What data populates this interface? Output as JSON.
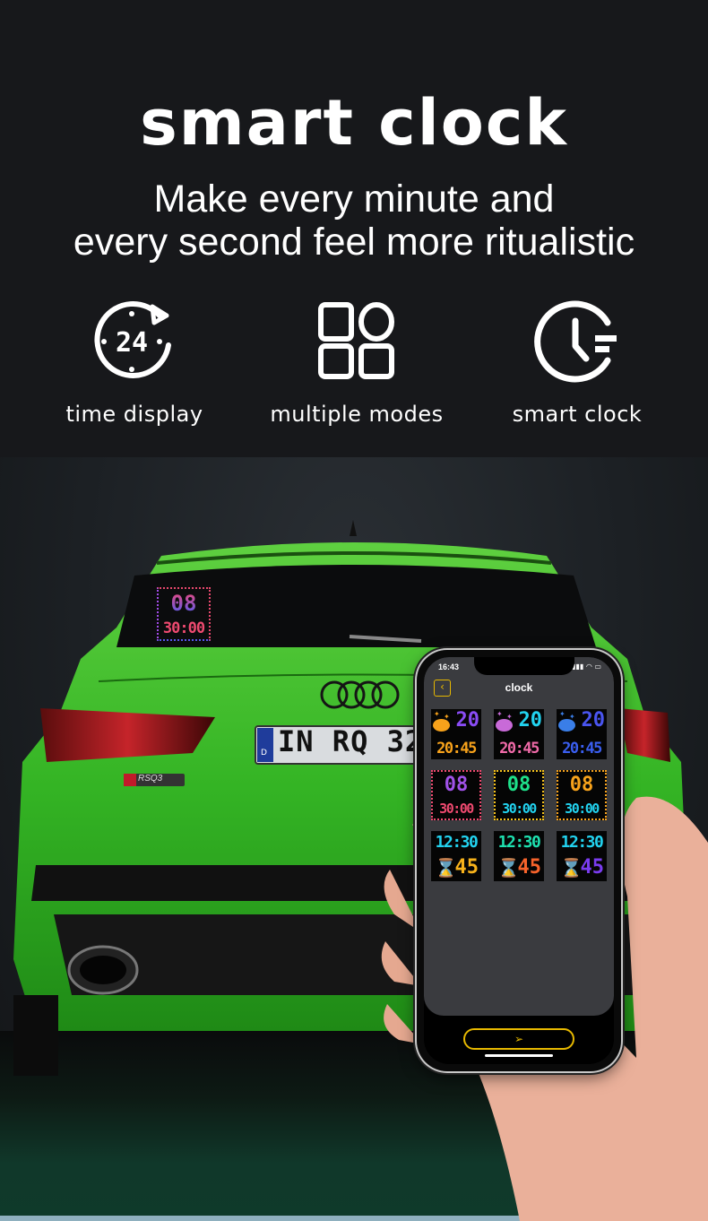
{
  "header": {
    "title": "smart clock",
    "subtitle_line1": "Make every minute and",
    "subtitle_line2": "every second feel more ritualistic"
  },
  "features": [
    {
      "icon": "clock-24h-icon",
      "label": "time display"
    },
    {
      "icon": "grid-modes-icon",
      "label": "multiple modes"
    },
    {
      "icon": "smart-clock-icon",
      "label": "smart clock"
    }
  ],
  "car": {
    "license_plate": "IN RQ 32",
    "plate_country": "D",
    "badge": "RSQ3",
    "window_display": {
      "hour": "08",
      "time": "30:00"
    }
  },
  "phone": {
    "status_time": "16:43",
    "status_icons": "▮▮▮ ◠ ▭",
    "back_icon": "‹",
    "screen_title": "clock",
    "send_icon": "➢",
    "clock_styles": [
      {
        "type": "planet",
        "top": "20",
        "bottom": "20:45",
        "colors": {
          "top": "#8a4cf5",
          "bottom": "#f7a21b",
          "planet": "#f7a21b",
          "sparkle": "#f7a21b"
        }
      },
      {
        "type": "planet",
        "top": "20",
        "bottom": "20:45",
        "colors": {
          "top": "#22d3f0",
          "bottom": "#f06aa8",
          "planet": "#c86ad8",
          "sparkle": "#c86ad8"
        }
      },
      {
        "type": "planet",
        "top": "20",
        "bottom": "20:45",
        "colors": {
          "top": "#4a55f0",
          "bottom": "#3a5ef0",
          "planet": "#3a7ee8",
          "sparkle": "#3a7ee8"
        }
      },
      {
        "type": "framed",
        "top": "08",
        "bottom": "30:00",
        "colors": {
          "top": "#a052e8",
          "bottom": "#ef4a70",
          "frame": "#ef4a70"
        }
      },
      {
        "type": "framed",
        "top": "08",
        "bottom": "30:00",
        "colors": {
          "top": "#1ee08a",
          "bottom": "#22d3f0",
          "frame": "#f7c21b"
        }
      },
      {
        "type": "framed",
        "top": "08",
        "bottom": "30:00",
        "colors": {
          "top": "#f7a21b",
          "bottom": "#22d3f0",
          "frame": "#f7a21b"
        }
      },
      {
        "type": "hourglass",
        "top": "12:30",
        "bottom": "45",
        "colors": {
          "top": "#22d3f0",
          "bottom": "#f7b21b",
          "glass": "#22d3f0"
        }
      },
      {
        "type": "hourglass",
        "top": "12:30",
        "bottom": "45",
        "colors": {
          "top": "#1ee0b0",
          "bottom": "#f7632b",
          "glass": "#1ee0b0"
        }
      },
      {
        "type": "hourglass",
        "top": "12:30",
        "bottom": "45",
        "colors": {
          "top": "#22d3f0",
          "bottom": "#7a3cf0",
          "glass": "#8a4cf5"
        }
      }
    ]
  },
  "colors": {
    "background": "#17181b",
    "accent_yellow": "#e6b800",
    "car_green": "#3fbf2a"
  }
}
